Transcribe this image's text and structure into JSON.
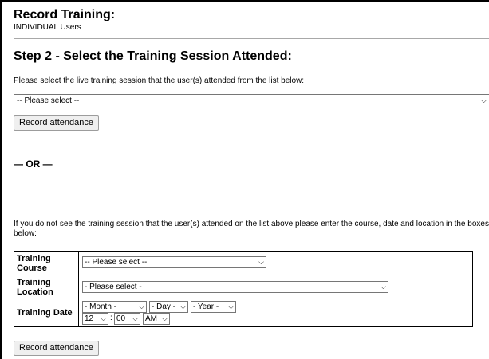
{
  "header": {
    "title": "Record Training:",
    "subtitle": "INDIVIDUAL Users"
  },
  "step2": {
    "heading": "Step 2 - Select the Training Session Attended:",
    "instruction": "Please select the live training session that the user(s) attended from the list below:",
    "session_select": {
      "value": "-- Please select --"
    },
    "record_button": "Record attendance"
  },
  "divider_text": "— OR —",
  "manual": {
    "instruction": "If you do not see the training session that the user(s) attended on the list above please enter the course, date and location in the boxes below:",
    "course": {
      "label": "Training Course",
      "value": "-- Please select --"
    },
    "location": {
      "label": "Training Location",
      "value": "- Please select -"
    },
    "date": {
      "label": "Training Date",
      "month": "- Month -",
      "day": "- Day -",
      "year": "- Year -",
      "hour": "12",
      "minute": "00",
      "ampm": "AM",
      "time_separator": ":"
    },
    "record_button": "Record attendance"
  },
  "icons": {
    "dropdown": "chevron-down-icon",
    "chevron_glyph": "⌵"
  }
}
